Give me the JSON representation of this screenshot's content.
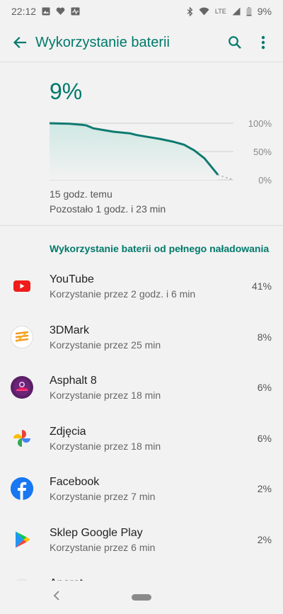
{
  "status": {
    "time": "22:12",
    "network": "LTE",
    "battery": "9%"
  },
  "appbar": {
    "title": "Wykorzystanie baterii",
    "back_icon": "arrow-back-icon",
    "search_icon": "search-icon",
    "more_icon": "more-vert-icon"
  },
  "summary": {
    "percent": "9%",
    "since": "15 godz. temu",
    "remaining": "Pozostało 1 godz. i 23 min"
  },
  "chart_data": {
    "type": "area",
    "y_ticks": [
      "100%",
      "50%",
      "0%"
    ],
    "ylim": [
      0,
      100
    ],
    "x": [
      0,
      0.12,
      0.2,
      0.22,
      0.26,
      0.32,
      0.38,
      0.48,
      0.52,
      0.58,
      0.66,
      0.74,
      0.8,
      0.86,
      0.92,
      1.0
    ],
    "values": [
      100,
      99,
      97,
      96,
      91,
      88,
      85,
      82,
      79,
      76,
      72,
      67,
      62,
      52,
      38,
      9
    ],
    "projection_end": 0,
    "grid": true,
    "colors": {
      "line": "#0f7a70",
      "fill": "#cfe8e3"
    }
  },
  "section_title": "Wykorzystanie baterii od pełnego naładowania",
  "apps": [
    {
      "name": "YouTube",
      "usage": "Korzystanie przez 2 godz. i 6 min",
      "percent": "41%",
      "icon": "youtube-icon"
    },
    {
      "name": "3DMark",
      "usage": "Korzystanie przez 25 min",
      "percent": "8%",
      "icon": "3dmark-icon"
    },
    {
      "name": "Asphalt 8",
      "usage": "Korzystanie przez 18 min",
      "percent": "6%",
      "icon": "asphalt-icon"
    },
    {
      "name": "Zdjęcia",
      "usage": "Korzystanie przez 18 min",
      "percent": "6%",
      "icon": "photos-icon"
    },
    {
      "name": "Facebook",
      "usage": "Korzystanie przez 7 min",
      "percent": "2%",
      "icon": "facebook-icon"
    },
    {
      "name": "Sklep Google Play",
      "usage": "Korzystanie przez 6 min",
      "percent": "2%",
      "icon": "play-store-icon"
    },
    {
      "name": "Aparat",
      "usage": "",
      "percent": "",
      "icon": "camera-icon"
    }
  ]
}
